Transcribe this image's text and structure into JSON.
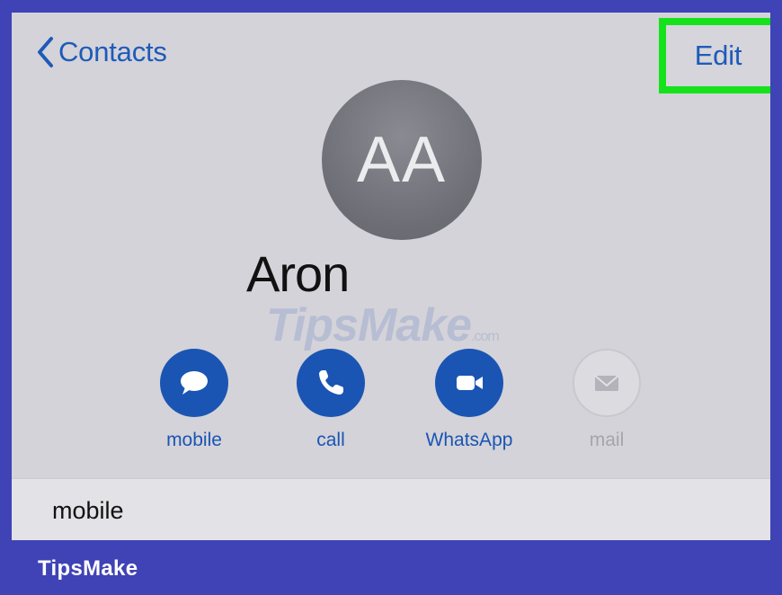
{
  "nav": {
    "back_label": "Contacts",
    "edit_label": "Edit"
  },
  "contact": {
    "initials": "AA",
    "name": "Aron"
  },
  "actions": [
    {
      "label": "mobile",
      "icon": "message-icon",
      "enabled": true
    },
    {
      "label": "call",
      "icon": "phone-icon",
      "enabled": true
    },
    {
      "label": "WhatsApp",
      "icon": "video-icon",
      "enabled": true
    },
    {
      "label": "mail",
      "icon": "mail-icon",
      "enabled": false
    }
  ],
  "details": {
    "mobile_label": "mobile"
  },
  "watermark": {
    "main": "TipsMake",
    "suffix": ".com"
  },
  "footer": {
    "brand": "TipsMake"
  },
  "colors": {
    "accent": "#1a55b3",
    "highlight": "#16e21b",
    "frame": "#3f43b6",
    "background": "#d4d3d9"
  }
}
